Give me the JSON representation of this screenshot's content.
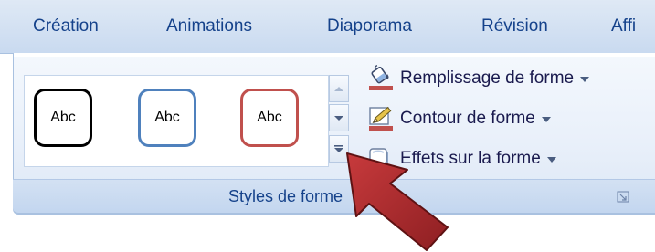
{
  "tabs": [
    {
      "label": "Création"
    },
    {
      "label": "Animations"
    },
    {
      "label": "Diaporama"
    },
    {
      "label": "Révision"
    },
    {
      "label": "Affi"
    }
  ],
  "gallery": {
    "styles": [
      {
        "label": "Abc",
        "border_color": "#000000"
      },
      {
        "label": "Abc",
        "border_color": "#4f81bd"
      },
      {
        "label": "Abc",
        "border_color": "#c0504d"
      }
    ]
  },
  "commands": {
    "fill_label": "Remplissage de forme",
    "outline_label": "Contour de forme",
    "effects_label": "Effets sur la forme"
  },
  "group": {
    "label": "Styles de forme"
  },
  "colors": {
    "fill_icon_bar": "#c0504d",
    "outline_icon_bar": "#c0504d",
    "arrow": "#a8282b",
    "tab_text": "#15428b"
  },
  "icons": {
    "fill": "paint-bucket-icon",
    "outline": "pencil-icon",
    "effects": "shape-effects-icon",
    "scroll_up": "chevron-up-icon",
    "scroll_down": "chevron-down-icon",
    "more": "gallery-more-icon",
    "launcher": "dialog-launcher-icon"
  }
}
